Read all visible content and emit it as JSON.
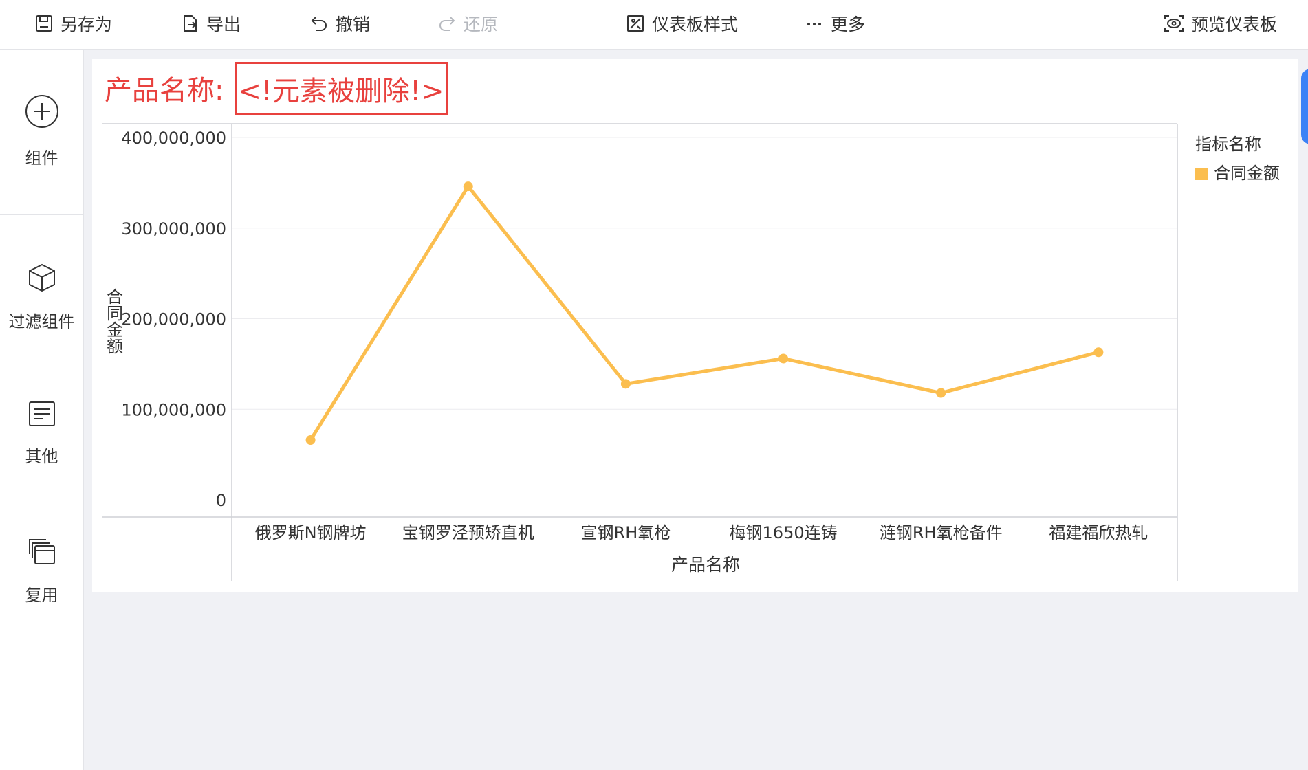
{
  "toolbar": {
    "save_as": "另存为",
    "export": "导出",
    "undo": "撤销",
    "redo": "还原",
    "dashboard_style": "仪表板样式",
    "more": "更多",
    "preview": "预览仪表板"
  },
  "sidebar": {
    "items": [
      {
        "label": "组件",
        "icon": "plus-circle-icon"
      },
      {
        "label": "过滤组件",
        "icon": "cube-icon"
      },
      {
        "label": "其他",
        "icon": "text-box-icon"
      },
      {
        "label": "复用",
        "icon": "layers-icon"
      }
    ]
  },
  "filter": {
    "label": "产品名称:",
    "value": "<!元素被删除!>"
  },
  "colors": {
    "accent_red": "#e8413e",
    "series": "#fbbe4f",
    "edge_tab": "#3b82f6"
  },
  "chart_data": {
    "type": "line",
    "categories": [
      "俄罗斯N钢牌坊",
      "宝钢罗泾预矫直机",
      "宣钢RH氧枪",
      "梅钢1650连铸",
      "涟钢RH氧枪备件",
      "福建福欣热轧"
    ],
    "series": [
      {
        "name": "合同金额",
        "values": [
          66000000,
          346000000,
          128000000,
          156000000,
          118000000,
          163000000
        ]
      }
    ],
    "xlabel": "产品名称",
    "ylabel": "合同金额",
    "ylim": [
      0,
      400000000
    ],
    "yticks": [
      0,
      100000000,
      200000000,
      300000000,
      400000000
    ],
    "ytick_labels": [
      "0",
      "100,000,000",
      "200,000,000",
      "300,000,000",
      "400,000,000"
    ],
    "legend_title": "指标名称",
    "legend_position": "right",
    "grid": true
  }
}
